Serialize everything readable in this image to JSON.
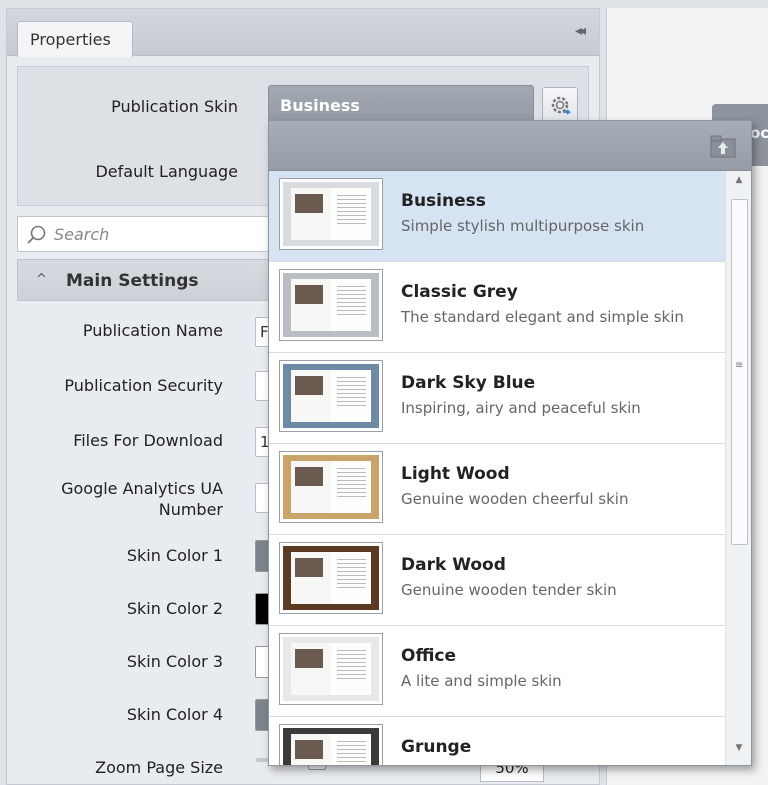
{
  "panel": {
    "tab_label": "Properties",
    "collapse_glyph": "◂◂"
  },
  "skin_row": {
    "skin_label": "Publication Skin",
    "skin_value": "Business",
    "language_label": "Default Language"
  },
  "search": {
    "placeholder": "Search"
  },
  "section": {
    "chevron": "^",
    "title": "Main Settings"
  },
  "properties": [
    {
      "label": "Publication Name",
      "value": "F"
    },
    {
      "label": "Publication Security",
      "value": ""
    },
    {
      "label": "Files For Download",
      "value": "1"
    },
    {
      "label_line1": "Google Analytics UA",
      "label_line2": "Number",
      "value": ""
    },
    {
      "label": "Skin Color 1",
      "color": "#7e848c"
    },
    {
      "label": "Skin Color 2",
      "color": "#000000"
    },
    {
      "label": "Skin Color 3",
      "color": "#ffffff"
    },
    {
      "label": "Skin Color 4",
      "color": "#7e848c"
    },
    {
      "label": "Zoom Page Size",
      "value": "50%"
    }
  ],
  "right_tab_text": "oc",
  "skins": [
    {
      "name": "Business",
      "desc": "Simple stylish multipurpose skin",
      "selected": true,
      "bg": "#d9dcdf"
    },
    {
      "name": "Classic Grey",
      "desc": "The standard elegant and simple skin",
      "selected": false,
      "bg": "#b9bec4"
    },
    {
      "name": "Dark Sky Blue",
      "desc": "Inspiring, airy and peaceful skin",
      "selected": false,
      "bg": "#6f8aa6"
    },
    {
      "name": "Light Wood",
      "desc": "Genuine wooden cheerful skin",
      "selected": false,
      "bg": "#c9a36a"
    },
    {
      "name": "Dark Wood",
      "desc": "Genuine wooden tender skin",
      "selected": false,
      "bg": "#5a3a22"
    },
    {
      "name": "Office",
      "desc": "A lite and simple skin",
      "selected": false,
      "bg": "#e6e8ea"
    },
    {
      "name": "Grunge",
      "desc": "",
      "selected": false,
      "bg": "#3a3a3a"
    }
  ],
  "scrollbar": {
    "up": "▲",
    "down": "▼",
    "grip": "≡"
  },
  "colors": {
    "accent_selected": "#d5e3f2",
    "dropdown_header": "#9ea4ae"
  }
}
